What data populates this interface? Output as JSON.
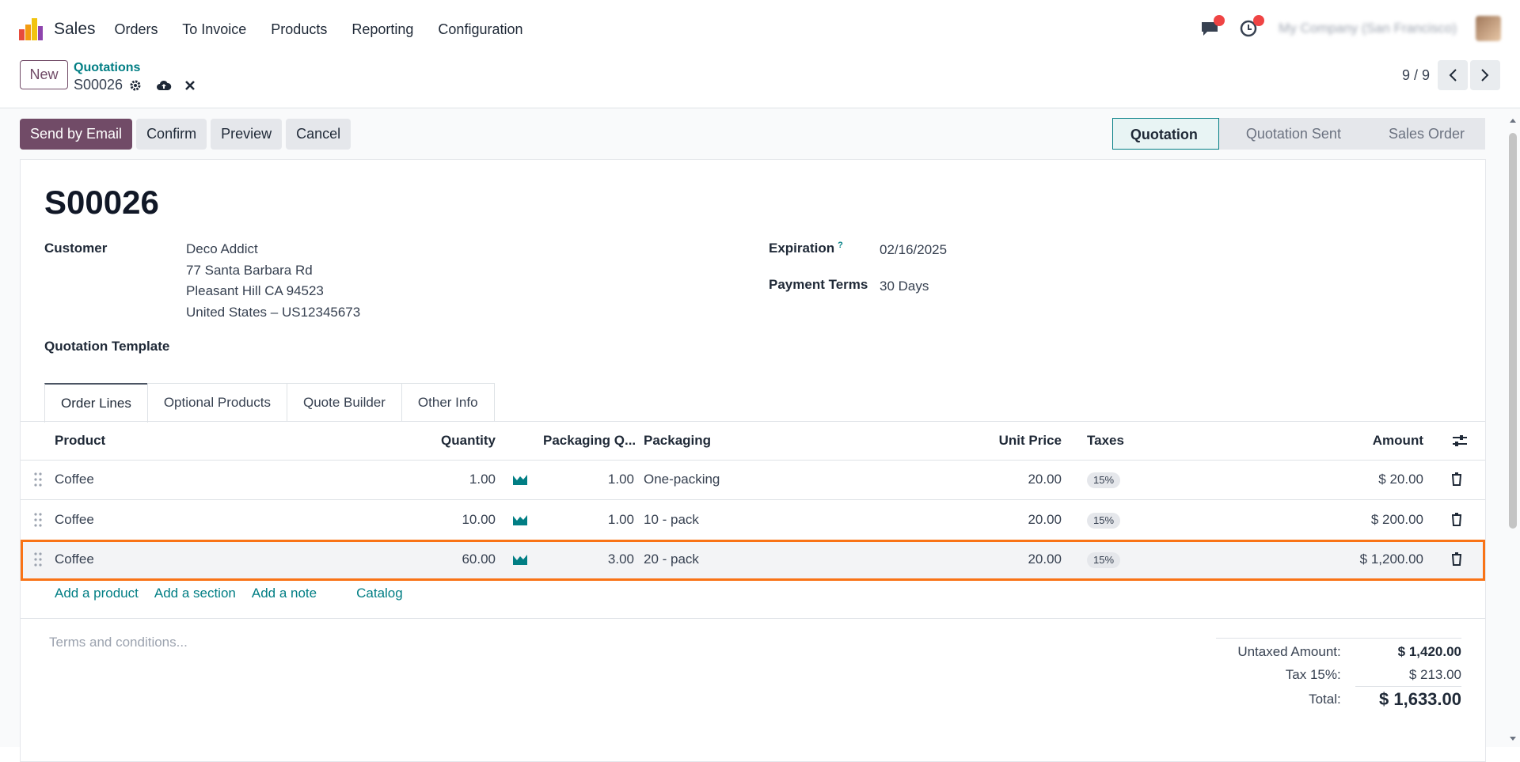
{
  "app": {
    "name": "Sales"
  },
  "menu": [
    "Orders",
    "To Invoice",
    "Products",
    "Reporting",
    "Configuration"
  ],
  "topright": {
    "company": "My Company (San Francisco)"
  },
  "control": {
    "new_label": "New",
    "breadcrumb_parent": "Quotations",
    "breadcrumb_current": "S00026",
    "pager": "9 / 9"
  },
  "actions": {
    "send": "Send by Email",
    "confirm": "Confirm",
    "preview": "Preview",
    "cancel": "Cancel"
  },
  "status": [
    "Quotation",
    "Quotation Sent",
    "Sales Order"
  ],
  "form": {
    "title": "S00026",
    "customer_label": "Customer",
    "customer_name": "Deco Addict",
    "address1": "77 Santa Barbara Rd",
    "address2": "Pleasant Hill CA 94523",
    "address3": "United States – US12345673",
    "template_label": "Quotation Template",
    "expiration_label": "Expiration",
    "expiration_help": "?",
    "expiration_value": "02/16/2025",
    "terms_label": "Payment Terms",
    "terms_value": "30 Days"
  },
  "tabs": [
    "Order Lines",
    "Optional Products",
    "Quote Builder",
    "Other Info"
  ],
  "table": {
    "headers": {
      "product": "Product",
      "quantity": "Quantity",
      "pkg_qty": "Packaging Q...",
      "packaging": "Packaging",
      "unit_price": "Unit Price",
      "taxes": "Taxes",
      "amount": "Amount"
    },
    "rows": [
      {
        "product": "Coffee",
        "quantity": "1.00",
        "pkg_qty": "1.00",
        "packaging": "One-packing",
        "unit_price": "20.00",
        "tax": "15%",
        "amount": "$ 20.00"
      },
      {
        "product": "Coffee",
        "quantity": "10.00",
        "pkg_qty": "1.00",
        "packaging": "10 - pack",
        "unit_price": "20.00",
        "tax": "15%",
        "amount": "$ 200.00"
      },
      {
        "product": "Coffee",
        "quantity": "60.00",
        "pkg_qty": "3.00",
        "packaging": "20 - pack",
        "unit_price": "20.00",
        "tax": "15%",
        "amount": "$ 1,200.00"
      }
    ]
  },
  "links": {
    "add_product": "Add a product",
    "add_section": "Add a section",
    "add_note": "Add a note",
    "catalog": "Catalog"
  },
  "terms_placeholder": "Terms and conditions...",
  "totals": {
    "untaxed_label": "Untaxed Amount:",
    "untaxed_value": "$ 1,420.00",
    "tax_label": "Tax 15%:",
    "tax_value": "$ 213.00",
    "total_label": "Total:",
    "total_value": "$ 1,633.00"
  },
  "colors": {
    "primary": "#714b67",
    "accent": "#017e84",
    "highlight": "#f97316"
  }
}
